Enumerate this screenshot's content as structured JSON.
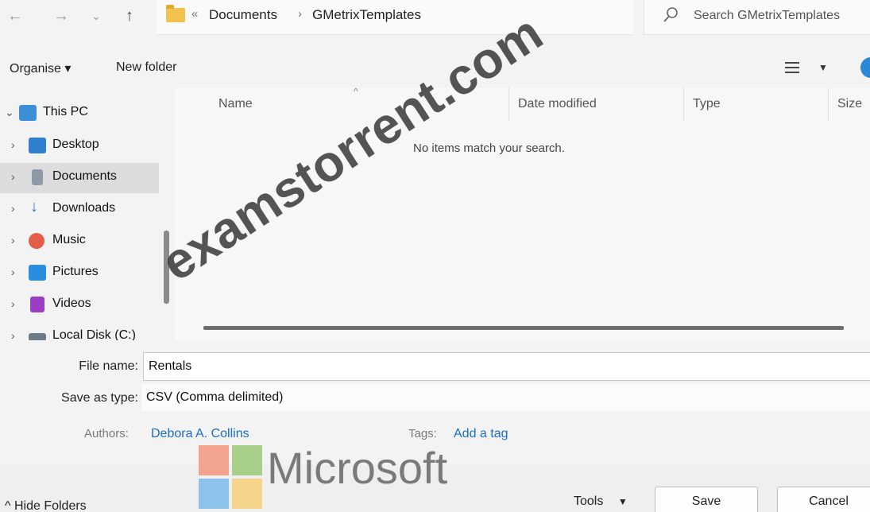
{
  "address_bar": {
    "prefix": "«",
    "crumbs": [
      "Documents",
      "GMetrixTemplates"
    ],
    "separator": "›",
    "search_placeholder": "Search GMetrixTemplates"
  },
  "toolbar": {
    "organise_label": "Organise ▾",
    "new_folder_label": "New folder"
  },
  "nav_pane": {
    "items": [
      {
        "label": "This PC",
        "icon": "this-pc-icon",
        "color": "#3d8fd8"
      },
      {
        "label": "Desktop",
        "icon": "desktop-icon",
        "color": "#2f7fcf"
      },
      {
        "label": "Documents",
        "icon": "documents-icon",
        "color": "#8d9aa6"
      },
      {
        "label": "Downloads",
        "icon": "downloads-icon",
        "color": "#2c7ad6"
      },
      {
        "label": "Music",
        "icon": "music-icon",
        "color": "#e35d4a"
      },
      {
        "label": "Pictures",
        "icon": "pictures-icon",
        "color": "#2b8de0"
      },
      {
        "label": "Videos",
        "icon": "videos-icon",
        "color": "#9a3fc5"
      },
      {
        "label": "Local Disk (C:)",
        "icon": "local-disk-icon",
        "color": "#6d7b87"
      }
    ],
    "selected": "Documents"
  },
  "file_list": {
    "columns": [
      "Name",
      "Date modified",
      "Type",
      "Size"
    ],
    "empty_message": "No items match your search."
  },
  "save_form": {
    "file_name_label": "File name:",
    "file_name_value": "Rentals",
    "save_type_label": "Save as type:",
    "save_type_value": "CSV (Comma delimited)",
    "authors_label": "Authors:",
    "authors_value": "Debora A. Collins",
    "tags_label": "Tags:",
    "tags_value": "Add a tag"
  },
  "bottom_bar": {
    "hide_folders_label": "Hide Folders",
    "tools_label": "Tools",
    "save_label": "Save",
    "cancel_label": "Cancel"
  },
  "overlays": {
    "watermark_text": "examstorrent.com",
    "logo_text": "Microsoft",
    "logo_colors": [
      "#f25022",
      "#7fba00",
      "#00a4ef",
      "#ffb900"
    ]
  },
  "colors": {
    "accent": "#2b88d8",
    "link": "#1a6ec7",
    "selected_bg": "#dcdcdc"
  }
}
